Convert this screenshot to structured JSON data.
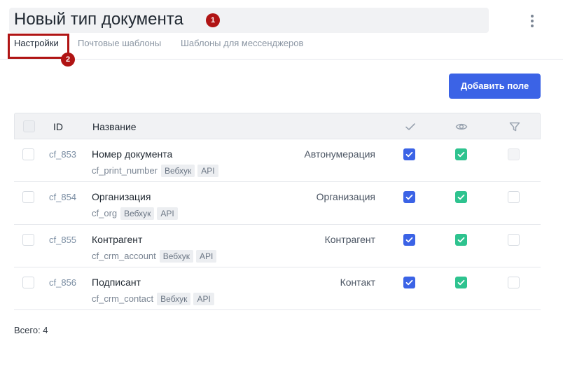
{
  "header": {
    "title": "Новый тип документа",
    "badge_1": "1",
    "badge_2": "2"
  },
  "tabs": [
    {
      "label": "Настройки",
      "active": true
    },
    {
      "label": "Почтовые шаблоны",
      "active": false
    },
    {
      "label": "Шаблоны для мессенджеров",
      "active": false
    }
  ],
  "toolbar": {
    "add_field_label": "Добавить поле"
  },
  "table": {
    "columns": {
      "id": "ID",
      "name": "Название",
      "required_icon": "check-icon",
      "visible_icon": "eye-icon",
      "filter_icon": "filter-icon"
    },
    "rows": [
      {
        "id": "cf_853",
        "name": "Номер документа",
        "code": "cf_print_number",
        "tags": [
          "Вебхук",
          "API"
        ],
        "type": "Автонумерация",
        "required": true,
        "visible": true,
        "filter": false,
        "filter_disabled": true
      },
      {
        "id": "cf_854",
        "name": "Организация",
        "code": "cf_org",
        "tags": [
          "Вебхук",
          "API"
        ],
        "type": "Организация",
        "required": true,
        "visible": true,
        "filter": false,
        "filter_disabled": false
      },
      {
        "id": "cf_855",
        "name": "Контрагент",
        "code": "cf_crm_account",
        "tags": [
          "Вебхук",
          "API"
        ],
        "type": "Контрагент",
        "required": true,
        "visible": true,
        "filter": false,
        "filter_disabled": false
      },
      {
        "id": "cf_856",
        "name": "Подписант",
        "code": "cf_crm_contact",
        "tags": [
          "Вебхук",
          "API"
        ],
        "type": "Контакт",
        "required": true,
        "visible": true,
        "filter": false,
        "filter_disabled": false
      }
    ]
  },
  "footer": {
    "total_label": "Всего: 4"
  },
  "colors": {
    "primary": "#3b63e6",
    "success": "#2ec38f",
    "annotation": "#b01414"
  }
}
